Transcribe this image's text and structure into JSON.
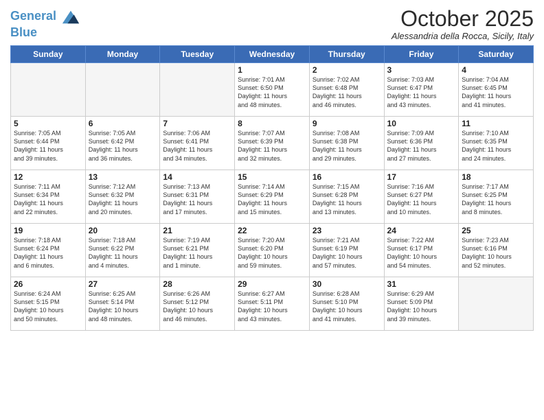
{
  "header": {
    "logo_line1": "General",
    "logo_line2": "Blue",
    "month": "October 2025",
    "location": "Alessandria della Rocca, Sicily, Italy"
  },
  "days_of_week": [
    "Sunday",
    "Monday",
    "Tuesday",
    "Wednesday",
    "Thursday",
    "Friday",
    "Saturday"
  ],
  "weeks": [
    [
      {
        "day": "",
        "info": ""
      },
      {
        "day": "",
        "info": ""
      },
      {
        "day": "",
        "info": ""
      },
      {
        "day": "1",
        "info": "Sunrise: 7:01 AM\nSunset: 6:50 PM\nDaylight: 11 hours\nand 48 minutes."
      },
      {
        "day": "2",
        "info": "Sunrise: 7:02 AM\nSunset: 6:48 PM\nDaylight: 11 hours\nand 46 minutes."
      },
      {
        "day": "3",
        "info": "Sunrise: 7:03 AM\nSunset: 6:47 PM\nDaylight: 11 hours\nand 43 minutes."
      },
      {
        "day": "4",
        "info": "Sunrise: 7:04 AM\nSunset: 6:45 PM\nDaylight: 11 hours\nand 41 minutes."
      }
    ],
    [
      {
        "day": "5",
        "info": "Sunrise: 7:05 AM\nSunset: 6:44 PM\nDaylight: 11 hours\nand 39 minutes."
      },
      {
        "day": "6",
        "info": "Sunrise: 7:05 AM\nSunset: 6:42 PM\nDaylight: 11 hours\nand 36 minutes."
      },
      {
        "day": "7",
        "info": "Sunrise: 7:06 AM\nSunset: 6:41 PM\nDaylight: 11 hours\nand 34 minutes."
      },
      {
        "day": "8",
        "info": "Sunrise: 7:07 AM\nSunset: 6:39 PM\nDaylight: 11 hours\nand 32 minutes."
      },
      {
        "day": "9",
        "info": "Sunrise: 7:08 AM\nSunset: 6:38 PM\nDaylight: 11 hours\nand 29 minutes."
      },
      {
        "day": "10",
        "info": "Sunrise: 7:09 AM\nSunset: 6:36 PM\nDaylight: 11 hours\nand 27 minutes."
      },
      {
        "day": "11",
        "info": "Sunrise: 7:10 AM\nSunset: 6:35 PM\nDaylight: 11 hours\nand 24 minutes."
      }
    ],
    [
      {
        "day": "12",
        "info": "Sunrise: 7:11 AM\nSunset: 6:34 PM\nDaylight: 11 hours\nand 22 minutes."
      },
      {
        "day": "13",
        "info": "Sunrise: 7:12 AM\nSunset: 6:32 PM\nDaylight: 11 hours\nand 20 minutes."
      },
      {
        "day": "14",
        "info": "Sunrise: 7:13 AM\nSunset: 6:31 PM\nDaylight: 11 hours\nand 17 minutes."
      },
      {
        "day": "15",
        "info": "Sunrise: 7:14 AM\nSunset: 6:29 PM\nDaylight: 11 hours\nand 15 minutes."
      },
      {
        "day": "16",
        "info": "Sunrise: 7:15 AM\nSunset: 6:28 PM\nDaylight: 11 hours\nand 13 minutes."
      },
      {
        "day": "17",
        "info": "Sunrise: 7:16 AM\nSunset: 6:27 PM\nDaylight: 11 hours\nand 10 minutes."
      },
      {
        "day": "18",
        "info": "Sunrise: 7:17 AM\nSunset: 6:25 PM\nDaylight: 11 hours\nand 8 minutes."
      }
    ],
    [
      {
        "day": "19",
        "info": "Sunrise: 7:18 AM\nSunset: 6:24 PM\nDaylight: 11 hours\nand 6 minutes."
      },
      {
        "day": "20",
        "info": "Sunrise: 7:18 AM\nSunset: 6:22 PM\nDaylight: 11 hours\nand 4 minutes."
      },
      {
        "day": "21",
        "info": "Sunrise: 7:19 AM\nSunset: 6:21 PM\nDaylight: 11 hours\nand 1 minute."
      },
      {
        "day": "22",
        "info": "Sunrise: 7:20 AM\nSunset: 6:20 PM\nDaylight: 10 hours\nand 59 minutes."
      },
      {
        "day": "23",
        "info": "Sunrise: 7:21 AM\nSunset: 6:19 PM\nDaylight: 10 hours\nand 57 minutes."
      },
      {
        "day": "24",
        "info": "Sunrise: 7:22 AM\nSunset: 6:17 PM\nDaylight: 10 hours\nand 54 minutes."
      },
      {
        "day": "25",
        "info": "Sunrise: 7:23 AM\nSunset: 6:16 PM\nDaylight: 10 hours\nand 52 minutes."
      }
    ],
    [
      {
        "day": "26",
        "info": "Sunrise: 6:24 AM\nSunset: 5:15 PM\nDaylight: 10 hours\nand 50 minutes."
      },
      {
        "day": "27",
        "info": "Sunrise: 6:25 AM\nSunset: 5:14 PM\nDaylight: 10 hours\nand 48 minutes."
      },
      {
        "day": "28",
        "info": "Sunrise: 6:26 AM\nSunset: 5:12 PM\nDaylight: 10 hours\nand 46 minutes."
      },
      {
        "day": "29",
        "info": "Sunrise: 6:27 AM\nSunset: 5:11 PM\nDaylight: 10 hours\nand 43 minutes."
      },
      {
        "day": "30",
        "info": "Sunrise: 6:28 AM\nSunset: 5:10 PM\nDaylight: 10 hours\nand 41 minutes."
      },
      {
        "day": "31",
        "info": "Sunrise: 6:29 AM\nSunset: 5:09 PM\nDaylight: 10 hours\nand 39 minutes."
      },
      {
        "day": "",
        "info": ""
      }
    ]
  ]
}
